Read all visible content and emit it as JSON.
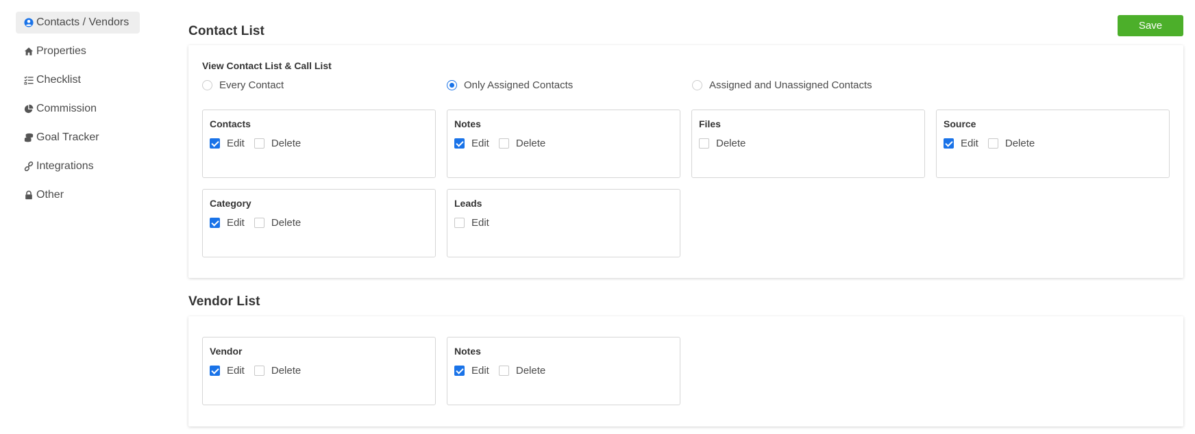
{
  "sidebar": {
    "items": [
      {
        "label": "Contacts / Vendors",
        "icon": "user-circle-icon",
        "active": true
      },
      {
        "label": "Properties",
        "icon": "home-icon",
        "active": false
      },
      {
        "label": "Checklist",
        "icon": "checklist-icon",
        "active": false
      },
      {
        "label": "Commission",
        "icon": "pie-chart-icon",
        "active": false
      },
      {
        "label": "Goal Tracker",
        "icon": "coins-stack-icon",
        "active": false
      },
      {
        "label": "Integrations",
        "icon": "link-icon",
        "active": false
      },
      {
        "label": "Other",
        "icon": "lock-icon",
        "active": false
      }
    ]
  },
  "toolbar": {
    "save_label": "Save"
  },
  "colors": {
    "save": "#4caf2a",
    "accent": "#1a73e8"
  },
  "contact_list": {
    "title": "Contact List",
    "view_label": "View Contact List & Call List",
    "radio_options": [
      {
        "label": "Every Contact",
        "checked": false
      },
      {
        "label": "Only Assigned Contacts",
        "checked": true
      },
      {
        "label": "Assigned and Unassigned Contacts",
        "checked": false
      }
    ],
    "permissions": [
      {
        "title": "Contacts",
        "options": [
          {
            "label": "Edit",
            "checked": true
          },
          {
            "label": "Delete",
            "checked": false
          }
        ]
      },
      {
        "title": "Notes",
        "options": [
          {
            "label": "Edit",
            "checked": true
          },
          {
            "label": "Delete",
            "checked": false
          }
        ]
      },
      {
        "title": "Files",
        "options": [
          {
            "label": "Delete",
            "checked": false
          }
        ]
      },
      {
        "title": "Source",
        "options": [
          {
            "label": "Edit",
            "checked": true
          },
          {
            "label": "Delete",
            "checked": false
          }
        ]
      },
      {
        "title": "Category",
        "options": [
          {
            "label": "Edit",
            "checked": true
          },
          {
            "label": "Delete",
            "checked": false
          }
        ]
      },
      {
        "title": "Leads",
        "options": [
          {
            "label": "Edit",
            "checked": false
          }
        ]
      }
    ]
  },
  "vendor_list": {
    "title": "Vendor List",
    "permissions": [
      {
        "title": "Vendor",
        "options": [
          {
            "label": "Edit",
            "checked": true
          },
          {
            "label": "Delete",
            "checked": false
          }
        ]
      },
      {
        "title": "Notes",
        "options": [
          {
            "label": "Edit",
            "checked": true
          },
          {
            "label": "Delete",
            "checked": false
          }
        ]
      }
    ]
  }
}
